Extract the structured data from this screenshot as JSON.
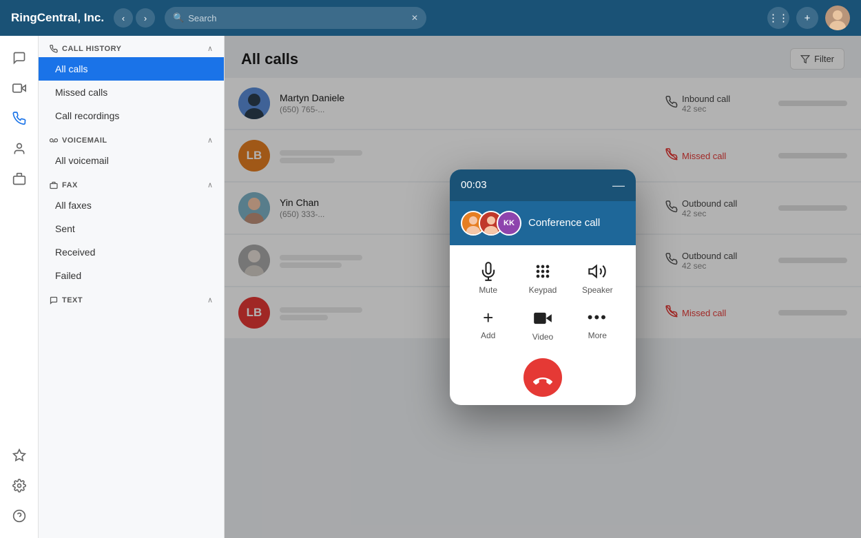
{
  "header": {
    "logo": "RingCentral, Inc.",
    "search_placeholder": "Search",
    "grid_icon": "⊞",
    "plus_icon": "+",
    "avatar_icon": "👤"
  },
  "icon_sidebar": {
    "items": [
      {
        "id": "chat",
        "icon": "💬",
        "label": "chat-icon"
      },
      {
        "id": "video",
        "icon": "📹",
        "label": "video-icon"
      },
      {
        "id": "phone",
        "icon": "📞",
        "label": "phone-icon",
        "active": true
      },
      {
        "id": "contacts",
        "icon": "👤",
        "label": "contacts-icon"
      },
      {
        "id": "fax",
        "icon": "📠",
        "label": "fax-icon"
      }
    ],
    "bottom_items": [
      {
        "id": "puzzle",
        "icon": "🧩",
        "label": "plugins-icon"
      },
      {
        "id": "settings",
        "icon": "⚙️",
        "label": "settings-icon"
      },
      {
        "id": "help",
        "icon": "❓",
        "label": "help-icon"
      }
    ]
  },
  "nav_sidebar": {
    "sections": [
      {
        "id": "call-history",
        "title": "CALL HISTORY",
        "icon": "📞",
        "items": [
          {
            "id": "all-calls",
            "label": "All calls",
            "active": true
          },
          {
            "id": "missed-calls",
            "label": "Missed calls"
          },
          {
            "id": "call-recordings",
            "label": "Call recordings"
          }
        ]
      },
      {
        "id": "voicemail",
        "title": "VOICEMAIL",
        "icon": "🎙",
        "items": [
          {
            "id": "all-voicemail",
            "label": "All voicemail"
          }
        ]
      },
      {
        "id": "fax",
        "title": "FAX",
        "icon": "📠",
        "items": [
          {
            "id": "all-faxes",
            "label": "All faxes"
          },
          {
            "id": "sent",
            "label": "Sent"
          },
          {
            "id": "received",
            "label": "Received"
          },
          {
            "id": "failed",
            "label": "Failed"
          }
        ]
      },
      {
        "id": "text",
        "title": "TEXT",
        "icon": "💬",
        "items": []
      }
    ]
  },
  "content": {
    "title": "All calls",
    "filter_label": "Filter",
    "calls": [
      {
        "id": 1,
        "name": "Martyn Daniele",
        "phone": "(650) 765-...",
        "type": "Inbound call",
        "duration": "42 sec",
        "missed": false,
        "avatar_bg": "#5b8dd9",
        "avatar_text": "",
        "has_photo": true
      },
      {
        "id": 2,
        "name": "",
        "phone": "",
        "type": "Missed call",
        "duration": "",
        "missed": true,
        "avatar_bg": "#e67e22",
        "avatar_text": "LB",
        "has_photo": false
      },
      {
        "id": 3,
        "name": "Yin Chan",
        "phone": "(650) 333-...",
        "type": "Outbound call",
        "duration": "42 sec",
        "missed": false,
        "avatar_bg": "#7fb3c8",
        "avatar_text": "",
        "has_photo": true
      },
      {
        "id": 4,
        "name": "",
        "phone": "",
        "type": "Outbound call",
        "duration": "42 sec",
        "missed": false,
        "avatar_bg": "#999",
        "avatar_text": "",
        "has_photo": true
      },
      {
        "id": 5,
        "name": "",
        "phone": "",
        "type": "Missed call",
        "duration": "",
        "missed": true,
        "avatar_bg": "#e53935",
        "avatar_text": "LB",
        "has_photo": false
      }
    ]
  },
  "call_modal": {
    "timer": "00:03",
    "minimize_icon": "—",
    "conference_label": "Conference call",
    "controls": [
      {
        "id": "mute",
        "icon": "🎤",
        "label": "Mute"
      },
      {
        "id": "keypad",
        "icon": "⌨",
        "label": "Keypad"
      },
      {
        "id": "speaker",
        "icon": "🔊",
        "label": "Speaker"
      }
    ],
    "controls2": [
      {
        "id": "add",
        "icon": "+",
        "label": "Add"
      },
      {
        "id": "video",
        "icon": "📷",
        "label": "Video"
      },
      {
        "id": "more",
        "icon": "•••",
        "label": "More"
      }
    ],
    "end_icon": "📵"
  }
}
